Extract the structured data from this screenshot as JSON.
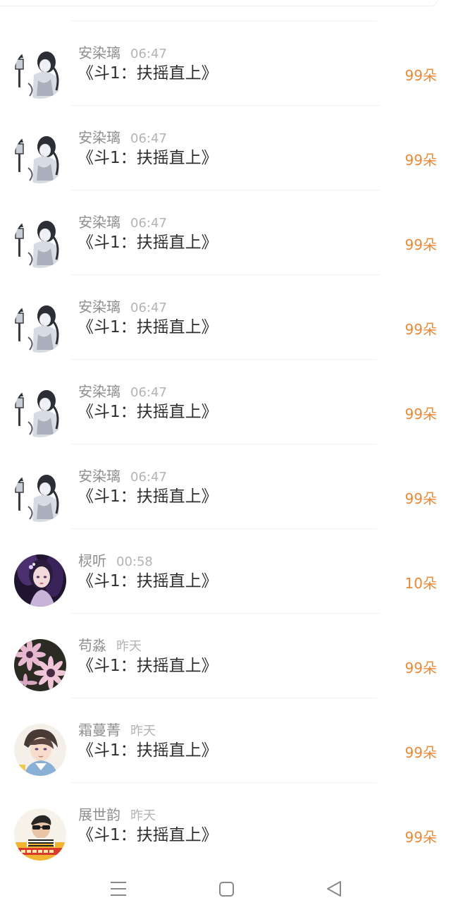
{
  "gift_list": [
    {
      "name": "安染璃",
      "time": "06:47",
      "gift": "《斗1：扶摇直上》",
      "count": "99朵",
      "avatar": "ink-wash-portrait"
    },
    {
      "name": "安染璃",
      "time": "06:47",
      "gift": "《斗1：扶摇直上》",
      "count": "99朵",
      "avatar": "ink-wash-portrait"
    },
    {
      "name": "安染璃",
      "time": "06:47",
      "gift": "《斗1：扶摇直上》",
      "count": "99朵",
      "avatar": "ink-wash-portrait"
    },
    {
      "name": "安染璃",
      "time": "06:47",
      "gift": "《斗1：扶摇直上》",
      "count": "99朵",
      "avatar": "ink-wash-portrait"
    },
    {
      "name": "安染璃",
      "time": "06:47",
      "gift": "《斗1：扶摇直上》",
      "count": "99朵",
      "avatar": "ink-wash-portrait"
    },
    {
      "name": "安染璃",
      "time": "06:47",
      "gift": "《斗1：扶摇直上》",
      "count": "99朵",
      "avatar": "ink-wash-portrait"
    },
    {
      "name": "棂听",
      "time": "00:58",
      "gift": "《斗1：扶摇直上》",
      "count": "10朵",
      "avatar": "purple-anime-girl"
    },
    {
      "name": "苟淼",
      "time": "昨天",
      "gift": "《斗1：扶摇直上》",
      "count": "99朵",
      "avatar": "pink-daisies"
    },
    {
      "name": "霜蔓菁",
      "time": "昨天",
      "gift": "《斗1：扶摇直上》",
      "count": "99朵",
      "avatar": "anime-boy"
    },
    {
      "name": "展世韵",
      "time": "昨天",
      "gift": "《斗1：扶摇直上》",
      "count": "99朵",
      "avatar": "man-with-sunglasses"
    }
  ],
  "navigation": {
    "menu_icon": "menu-lines-icon",
    "home_icon": "home-square-icon",
    "back_icon": "back-triangle-icon"
  },
  "colors": {
    "accent": "#e8893a",
    "name": "#8e8e8e",
    "time": "#b3b3b3",
    "title": "#2e2e2e"
  }
}
